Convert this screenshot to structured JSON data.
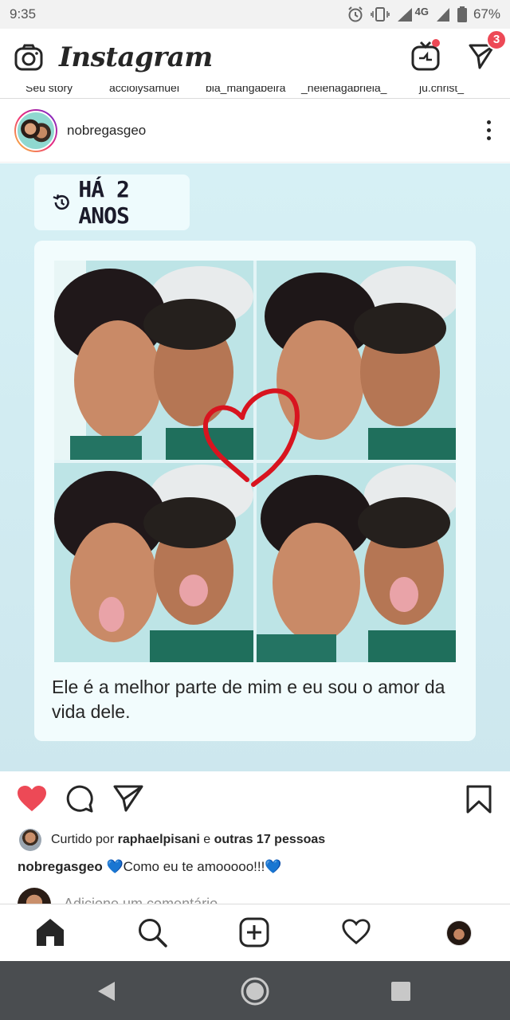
{
  "status_bar": {
    "time": "9:35",
    "network": "4G",
    "battery": "67%"
  },
  "app": {
    "name": "Instagram",
    "dm_badge": "3",
    "accent": "#ed4956"
  },
  "stories": [
    "Seu story",
    "acciolysamuel",
    "bia_mangabeira",
    "_helenagabriela_",
    "ju.christ_"
  ],
  "post": {
    "username": "nobregasgeo",
    "memory_label": "HÁ 2 ANOS",
    "memory_text": "Ele é a melhor parte de mim e eu sou o amor da vida dele.",
    "liked": true,
    "liked_by_prefix": "Curtido por",
    "liked_by_user": "raphaelpisani",
    "liked_by_joiner": "e",
    "liked_by_others": "outras 17 pessoas",
    "caption_user": "nobregasgeo",
    "caption_text": "💙Como eu te amooooo!!!💙",
    "comment_placeholder": "Adicione um comentário..."
  },
  "icons": {
    "camera": "camera-icon",
    "igtv": "igtv-icon",
    "direct": "direct-icon",
    "more": "more-icon",
    "like": "heart-filled-icon",
    "comment": "comment-icon",
    "share": "share-icon",
    "save": "bookmark-icon",
    "home": "home-icon",
    "search": "search-icon",
    "new_post": "add-icon",
    "activity": "heart-icon",
    "profile": "profile-avatar"
  }
}
